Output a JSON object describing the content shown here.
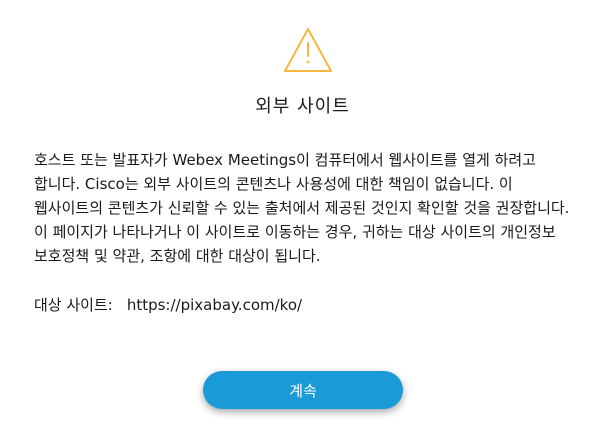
{
  "dialog": {
    "icon": "warning-triangle-icon",
    "title": "외부 사이트",
    "message": "호스트 또는 발표자가 Webex Meetings이 컴퓨터에서 웹사이트를 열게 하려고 합니다. Cisco는 외부 사이트의 콘텐츠나 사용성에 대한 책임이 없습니다. 이 웹사이트의 콘텐츠가 신뢰할 수 있는 출처에서 제공된 것인지 확인할 것을 권장합니다. 이 페이지가 나타나거나 이 사이트로 이동하는 경우, 귀하는 대상 사이트의 개인정보 보호정책 및 약관, 조항에 대한 대상이 됩니다.",
    "site_label": "대상 사이트:",
    "site_url": "https://pixabay.com/ko/",
    "continue_label": "계속"
  },
  "colors": {
    "warning": "#f5b642",
    "button": "#1a9ad6",
    "text": "#1a1a1a"
  }
}
